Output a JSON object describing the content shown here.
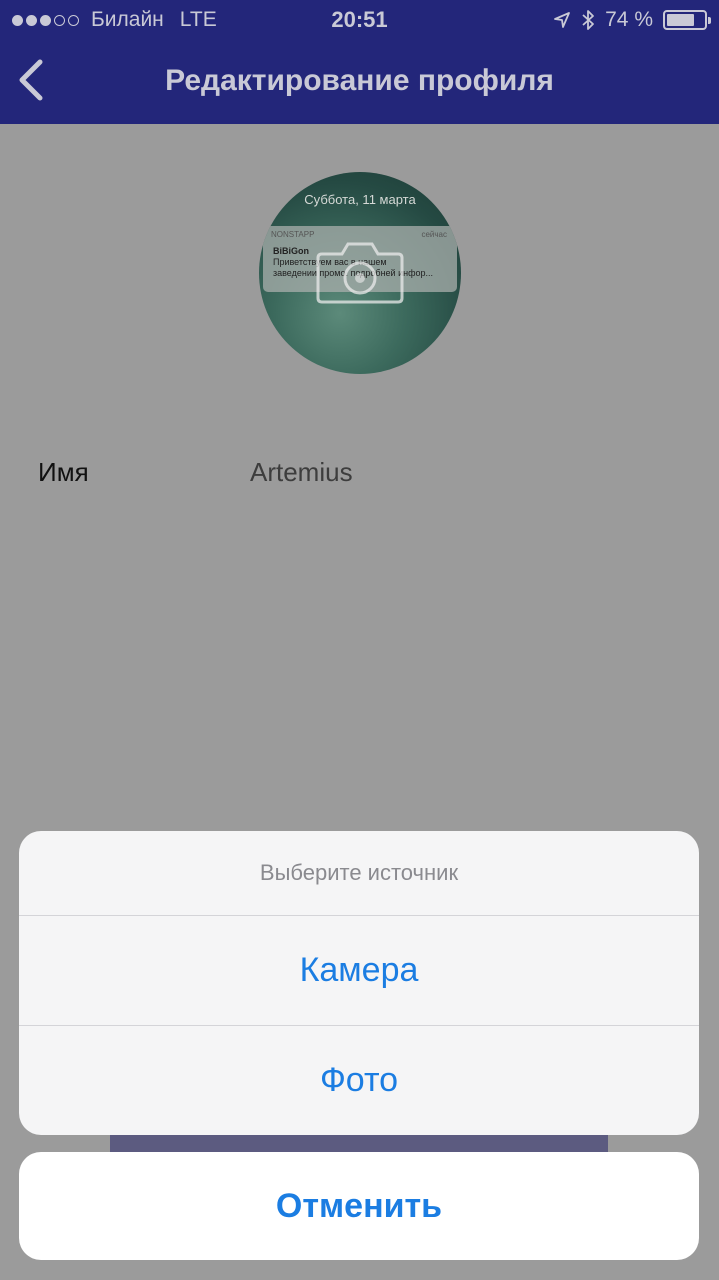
{
  "status_bar": {
    "carrier": "Билайн",
    "network": "LTE",
    "time": "20:51",
    "battery_text": "74 %",
    "battery_level": 0.74,
    "icons": [
      "signal-dots",
      "location-arrow-icon",
      "bluetooth-icon",
      "battery-icon"
    ]
  },
  "nav": {
    "title": "Редактирование профиля",
    "back_icon": "chevron-left-icon"
  },
  "profile": {
    "avatar": {
      "date": "Суббота, 11 марта",
      "notification": {
        "app": "NONSTAPP",
        "time": "сейчас",
        "title": "BiBiGon",
        "line1": "Приветствуем вас в нашем",
        "line2": "заведении промо. подробней инфор..."
      },
      "overlay_icon": "camera-icon"
    },
    "name_label": "Имя",
    "name_value": "Artemius"
  },
  "action_sheet": {
    "title": "Выберите источник",
    "options": [
      "Камера",
      "Фото"
    ],
    "cancel": "Отменить"
  },
  "colors": {
    "nav_bg": "#23267a",
    "dim_bg": "#9b9b9b",
    "action_blue": "#1b7de2"
  }
}
